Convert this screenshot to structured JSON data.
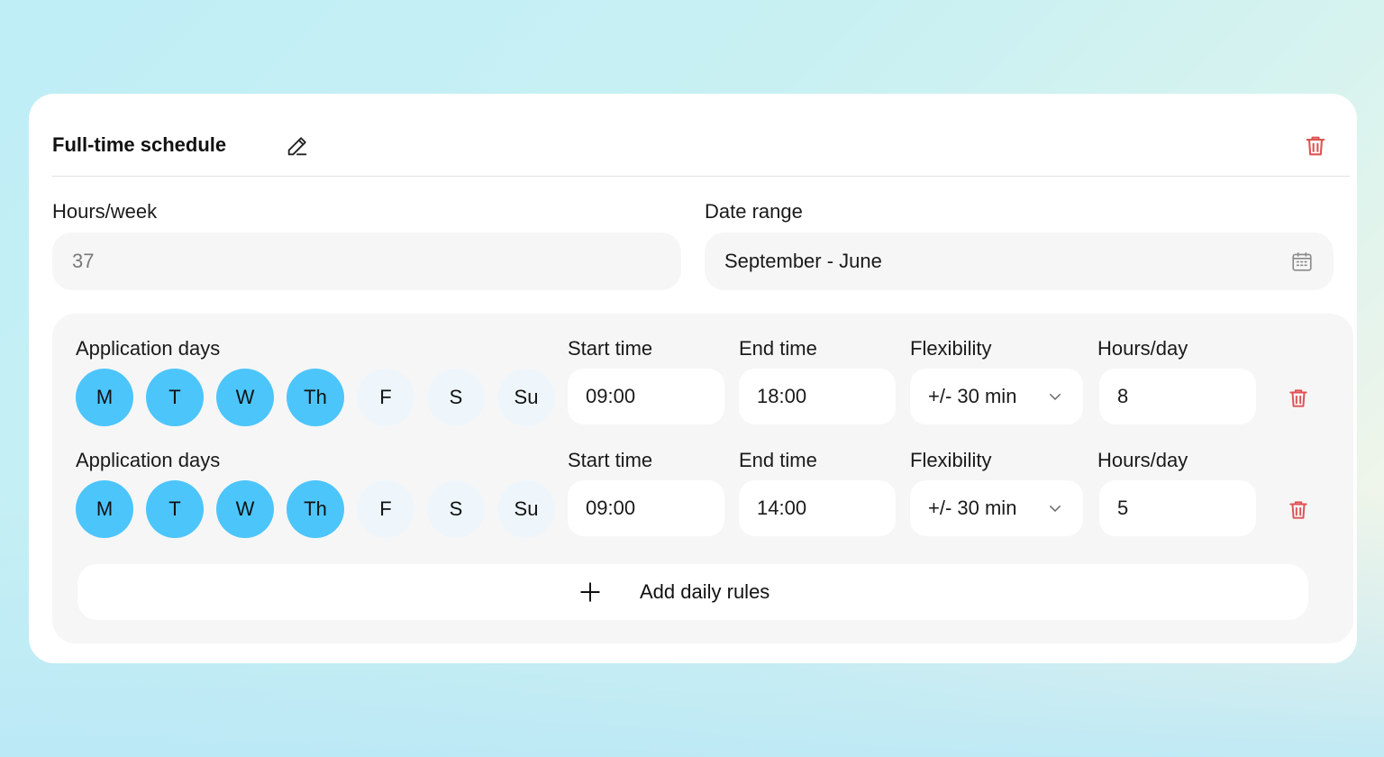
{
  "card": {
    "title": "Full-time schedule",
    "hours_week": {
      "label": "Hours/week",
      "value": "37"
    },
    "date_range": {
      "label": "Date range",
      "value": "September - June"
    }
  },
  "rules": [
    {
      "days_label": "Application days",
      "days": [
        {
          "label": "M",
          "selected": true
        },
        {
          "label": "T",
          "selected": true
        },
        {
          "label": "W",
          "selected": true
        },
        {
          "label": "Th",
          "selected": true
        },
        {
          "label": "F",
          "selected": false
        },
        {
          "label": "S",
          "selected": false
        },
        {
          "label": "Su",
          "selected": false
        }
      ],
      "start_label": "Start time",
      "start": "09:00",
      "end_label": "End time",
      "end": "18:00",
      "flex_label": "Flexibility",
      "flex": "+/- 30 min",
      "hours_label": "Hours/day",
      "hours": "8"
    },
    {
      "days_label": "Application days",
      "days": [
        {
          "label": "M",
          "selected": true
        },
        {
          "label": "T",
          "selected": true
        },
        {
          "label": "W",
          "selected": true
        },
        {
          "label": "Th",
          "selected": true
        },
        {
          "label": "F",
          "selected": false
        },
        {
          "label": "S",
          "selected": false
        },
        {
          "label": "Su",
          "selected": false
        }
      ],
      "start_label": "Start time",
      "start": "09:00",
      "end_label": "End time",
      "end": "14:00",
      "flex_label": "Flexibility",
      "flex": "+/- 30 min",
      "hours_label": "Hours/day",
      "hours": "5"
    }
  ],
  "add_rules_label": "Add daily rules",
  "colors": {
    "day_selected": "#4cc5fb",
    "day_unselected": "#eef6fb",
    "delete": "#e05252"
  },
  "icons": [
    "edit-icon",
    "trash-icon",
    "calendar-icon",
    "chevron-down-icon",
    "plus-icon"
  ]
}
